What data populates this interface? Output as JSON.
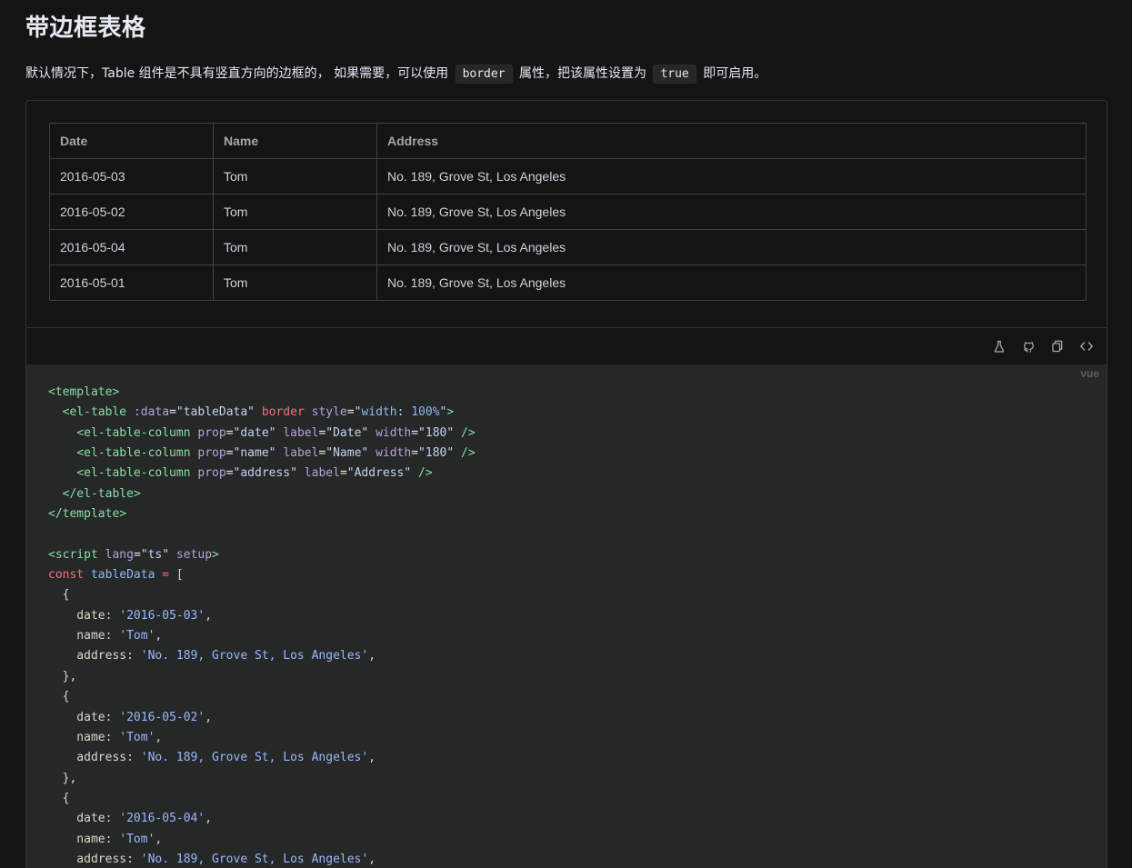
{
  "title": "带边框表格",
  "description": {
    "before": "默认情况下，Table 组件是不具有竖直方向的边框的， 如果需要，可以使用",
    "code1": "border",
    "middle": "属性，把该属性设置为",
    "code2": "true",
    "after": "即可启用。"
  },
  "table": {
    "headers": [
      "Date",
      "Name",
      "Address"
    ],
    "rows": [
      [
        "2016-05-03",
        "Tom",
        "No. 189, Grove St, Los Angeles"
      ],
      [
        "2016-05-02",
        "Tom",
        "No. 189, Grove St, Los Angeles"
      ],
      [
        "2016-05-04",
        "Tom",
        "No. 189, Grove St, Los Angeles"
      ],
      [
        "2016-05-01",
        "Tom",
        "No. 189, Grove St, Los Angeles"
      ]
    ]
  },
  "toolbar": {
    "icons": [
      "playground-icon",
      "github-icon",
      "copy-icon",
      "code-icon"
    ]
  },
  "code": {
    "lang": "vue",
    "lines": [
      [
        [
          "tag",
          "<"
        ],
        [
          "tag",
          "template"
        ],
        [
          "tag",
          ">"
        ]
      ],
      [
        [
          "plain",
          "  "
        ],
        [
          "tag",
          "<el-table"
        ],
        [
          "plain",
          " "
        ],
        [
          "attr",
          ":data"
        ],
        [
          "eq",
          "="
        ],
        [
          "str",
          "\"tableData\""
        ],
        [
          "plain",
          " "
        ],
        [
          "kw",
          "border"
        ],
        [
          "plain",
          " "
        ],
        [
          "attr",
          "style"
        ],
        [
          "eq",
          "="
        ],
        [
          "str",
          "\""
        ],
        [
          "var",
          "width"
        ],
        [
          "str",
          ": "
        ],
        [
          "num",
          "100%"
        ],
        [
          "str",
          "\""
        ],
        [
          "tag",
          ">"
        ]
      ],
      [
        [
          "plain",
          "    "
        ],
        [
          "tag",
          "<el-table-column"
        ],
        [
          "plain",
          " "
        ],
        [
          "attr",
          "prop"
        ],
        [
          "eq",
          "="
        ],
        [
          "str",
          "\"date\""
        ],
        [
          "plain",
          " "
        ],
        [
          "attr",
          "label"
        ],
        [
          "eq",
          "="
        ],
        [
          "str",
          "\"Date\""
        ],
        [
          "plain",
          " "
        ],
        [
          "attr",
          "width"
        ],
        [
          "eq",
          "="
        ],
        [
          "str",
          "\"180\""
        ],
        [
          "plain",
          " "
        ],
        [
          "tag",
          "/>"
        ]
      ],
      [
        [
          "plain",
          "    "
        ],
        [
          "tag",
          "<el-table-column"
        ],
        [
          "plain",
          " "
        ],
        [
          "attr",
          "prop"
        ],
        [
          "eq",
          "="
        ],
        [
          "str",
          "\"name\""
        ],
        [
          "plain",
          " "
        ],
        [
          "attr",
          "label"
        ],
        [
          "eq",
          "="
        ],
        [
          "str",
          "\"Name\""
        ],
        [
          "plain",
          " "
        ],
        [
          "attr",
          "width"
        ],
        [
          "eq",
          "="
        ],
        [
          "str",
          "\"180\""
        ],
        [
          "plain",
          " "
        ],
        [
          "tag",
          "/>"
        ]
      ],
      [
        [
          "plain",
          "    "
        ],
        [
          "tag",
          "<el-table-column"
        ],
        [
          "plain",
          " "
        ],
        [
          "attr",
          "prop"
        ],
        [
          "eq",
          "="
        ],
        [
          "str",
          "\"address\""
        ],
        [
          "plain",
          " "
        ],
        [
          "attr",
          "label"
        ],
        [
          "eq",
          "="
        ],
        [
          "str",
          "\"Address\""
        ],
        [
          "plain",
          " "
        ],
        [
          "tag",
          "/>"
        ]
      ],
      [
        [
          "plain",
          "  "
        ],
        [
          "tag",
          "</el-table>"
        ]
      ],
      [
        [
          "tag",
          "</template>"
        ]
      ],
      [
        [
          "plain",
          ""
        ]
      ],
      [
        [
          "tag",
          "<script"
        ],
        [
          "plain",
          " "
        ],
        [
          "attr",
          "lang"
        ],
        [
          "eq",
          "="
        ],
        [
          "str",
          "\"ts\""
        ],
        [
          "plain",
          " "
        ],
        [
          "attr",
          "setup"
        ],
        [
          "tag",
          ">"
        ]
      ],
      [
        [
          "kw",
          "const"
        ],
        [
          "plain",
          " "
        ],
        [
          "var",
          "tableData"
        ],
        [
          "plain",
          " "
        ],
        [
          "kw",
          "="
        ],
        [
          "plain",
          " ["
        ]
      ],
      [
        [
          "plain",
          "  {"
        ]
      ],
      [
        [
          "plain",
          "    date: "
        ],
        [
          "sstr",
          "'2016-05-03'"
        ],
        [
          "plain",
          ","
        ]
      ],
      [
        [
          "plain",
          "    name: "
        ],
        [
          "sstr",
          "'Tom'"
        ],
        [
          "plain",
          ","
        ]
      ],
      [
        [
          "plain",
          "    address: "
        ],
        [
          "sstr",
          "'No. 189, Grove St, Los Angeles'"
        ],
        [
          "plain",
          ","
        ]
      ],
      [
        [
          "plain",
          "  },"
        ]
      ],
      [
        [
          "plain",
          "  {"
        ]
      ],
      [
        [
          "plain",
          "    date: "
        ],
        [
          "sstr",
          "'2016-05-02'"
        ],
        [
          "plain",
          ","
        ]
      ],
      [
        [
          "plain",
          "    name: "
        ],
        [
          "sstr",
          "'Tom'"
        ],
        [
          "plain",
          ","
        ]
      ],
      [
        [
          "plain",
          "    address: "
        ],
        [
          "sstr",
          "'No. 189, Grove St, Los Angeles'"
        ],
        [
          "plain",
          ","
        ]
      ],
      [
        [
          "plain",
          "  },"
        ]
      ],
      [
        [
          "plain",
          "  {"
        ]
      ],
      [
        [
          "plain",
          "    date: "
        ],
        [
          "sstr",
          "'2016-05-04'"
        ],
        [
          "plain",
          ","
        ]
      ],
      [
        [
          "plain",
          "    name: "
        ],
        [
          "sstr",
          "'Tom'"
        ],
        [
          "plain",
          ","
        ]
      ],
      [
        [
          "plain",
          "    address: "
        ],
        [
          "sstr",
          "'No. 189, Grove St, Los Angeles'"
        ],
        [
          "plain",
          ","
        ]
      ]
    ]
  }
}
